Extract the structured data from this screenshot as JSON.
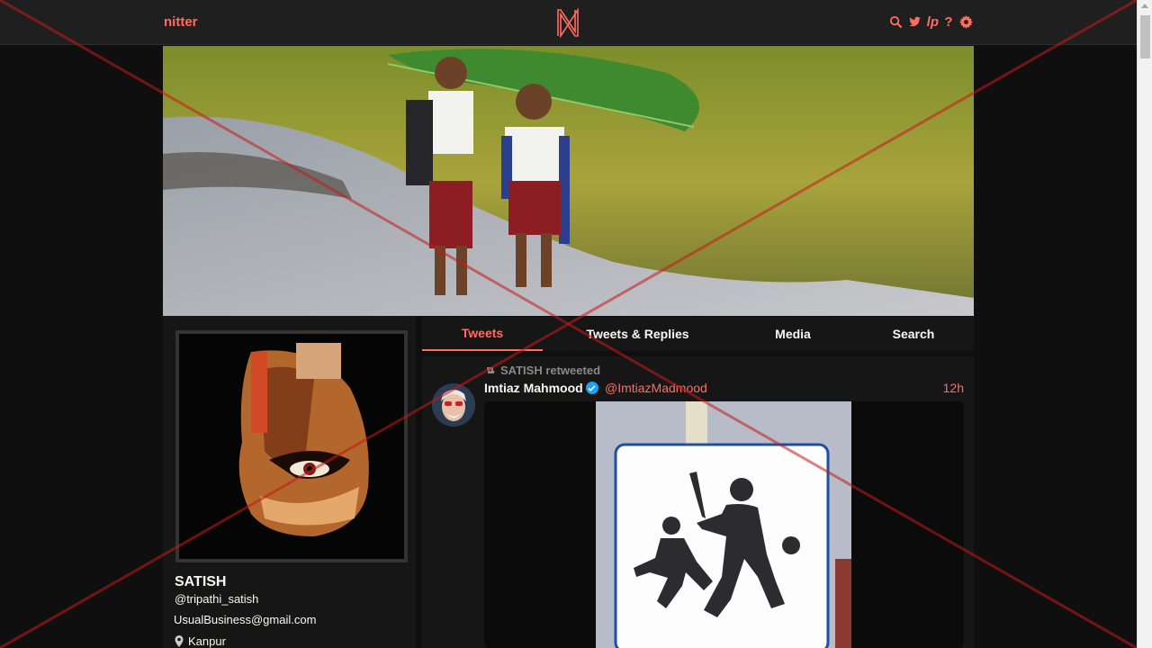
{
  "navbar": {
    "brand": "nitter",
    "logo_letter": "N",
    "icons": [
      "search-icon",
      "twitter-icon",
      "rss-icon",
      "help-icon",
      "gear-icon"
    ],
    "lp_text": "lp",
    "help_text": "?"
  },
  "profile": {
    "fullname": "SATISH",
    "username": "@tripathi_satish",
    "bio": "UsualBusiness@gmail.com",
    "location": "Kanpur"
  },
  "tabs": [
    {
      "label": "Tweets",
      "active": true
    },
    {
      "label": "Tweets & Replies",
      "active": false
    },
    {
      "label": "Media",
      "active": false
    },
    {
      "label": "Search",
      "active": false
    }
  ],
  "tweet": {
    "retweet_header": "SATISH retweeted",
    "fullname": "Imtiaz Mahmood",
    "handle": "@ImtiazMadmood",
    "date": "12h",
    "verified": true
  },
  "colors": {
    "accent": "#ff6c60",
    "background": "#0f0f0f",
    "panel": "#161616",
    "navbar": "#1f1f1f"
  }
}
